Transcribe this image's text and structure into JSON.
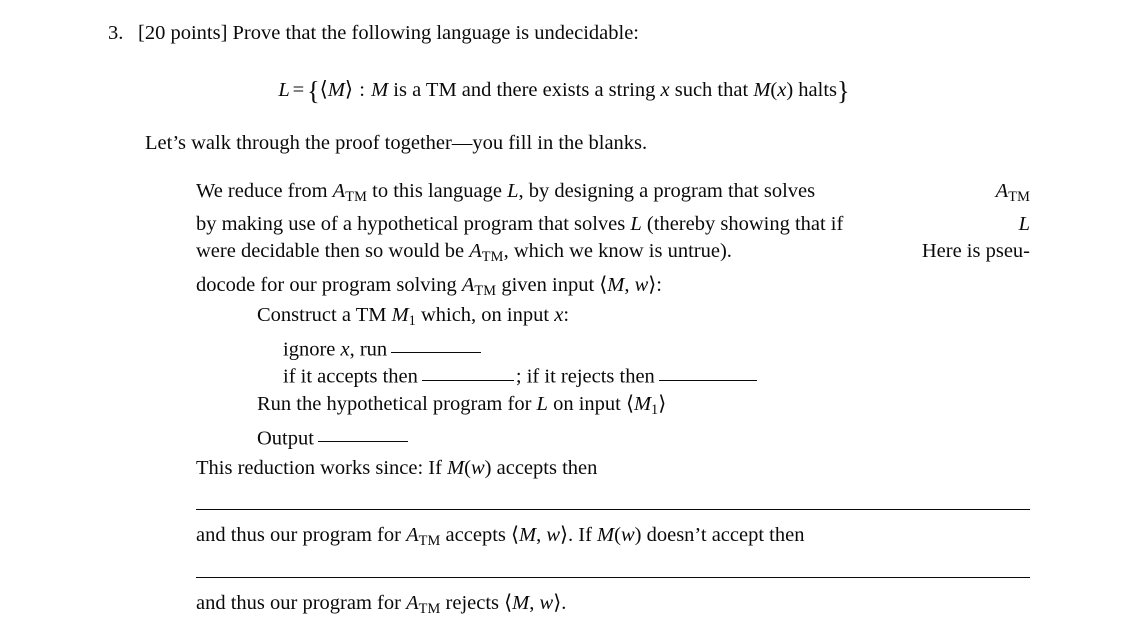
{
  "problem": {
    "number": "3.",
    "points_label": "[20 points]",
    "prompt": "Prove that the following language is undecidable:"
  },
  "equation": {
    "lhs": "L",
    "relation": "=",
    "open_brace": "{",
    "open_angle": "⟨",
    "machine": "M",
    "close_angle": "⟩",
    "colon": ":",
    "body_1": "M",
    "body_2": "is a TM and there exists a string",
    "var_x": "x",
    "body_3": "such that",
    "body_4": "M",
    "body_5": "(",
    "body_6": "x",
    "body_7": ")",
    "body_8": "halts",
    "close_brace": "}"
  },
  "intro": {
    "text": "Let’s walk through the proof together—you fill in the blanks."
  },
  "paragraph": {
    "line1_a": "We reduce from ",
    "line1_atm": "A",
    "line1_sub": "TM",
    "line1_b": " to this language ",
    "line1_L": "L",
    "line1_c": ", by designing a program that solves ",
    "line1_atm2": "A",
    "line1_sub2": "TM",
    "line2_a": "by making use of a hypothetical program that solves ",
    "line2_L": "L",
    "line2_b": " (thereby showing that if ",
    "line2_L2": "L",
    "line3_a": "were decidable then so would be ",
    "line3_atm": "A",
    "line3_sub": "TM",
    "line3_b": ", which we know is untrue).",
    "line3_c": "Here is pseu-",
    "line4_a": "docode for our program solving ",
    "line4_atm": "A",
    "line4_sub": "TM",
    "line4_b": " given input ",
    "line4_angl": "⟨",
    "line4_M": "M",
    "line4_comma": ", ",
    "line4_w": "w",
    "line4_angr": "⟩",
    "line4_colon": ":"
  },
  "pseudocode": {
    "line1_a": "Construct a TM ",
    "line1_M": "M",
    "line1_sub": "1",
    "line1_b": " which, on input ",
    "line1_x": "x",
    "line1_c": ":",
    "line2_a": "ignore ",
    "line2_x": "x",
    "line2_b": ", run",
    "line2_blank": "",
    "line3_a": "if it accepts then",
    "line3_blank1": "",
    "line3_b": "; if it rejects then",
    "line3_blank2": "",
    "line4_a": "Run the hypothetical program for ",
    "line4_L": "L",
    "line4_b": " on input ",
    "line4_angl": "⟨",
    "line4_M": "M",
    "line4_sub": "1",
    "line4_angr": "⟩",
    "line5_a": "Output",
    "line5_blank": ""
  },
  "closing": {
    "line1_a": "This reduction works since: If ",
    "line1_M": "M",
    "line1_lp": "(",
    "line1_w": "w",
    "line1_rp": ")",
    "line1_b": " accepts then",
    "line2_a": "and thus our program for ",
    "line2_atm": "A",
    "line2_sub": "TM",
    "line2_b": " accepts ",
    "line2_angl": "⟨",
    "line2_M": "M",
    "line2_comma": ", ",
    "line2_w": "w",
    "line2_angr": "⟩",
    "line2_c": ". If ",
    "line2_M2": "M",
    "line2_lp": "(",
    "line2_w2": "w",
    "line2_rp": ")",
    "line2_d": " doesn’t accept then",
    "line3_a": "and thus our program for ",
    "line3_atm": "A",
    "line3_sub": "TM",
    "line3_b": " rejects ",
    "line3_angl": "⟨",
    "line3_M": "M",
    "line3_comma": ", ",
    "line3_w": "w",
    "line3_angr": "⟩",
    "line3_c": "."
  },
  "colors": {
    "ink": "#0a0a0a",
    "paper": "#ffffff"
  }
}
